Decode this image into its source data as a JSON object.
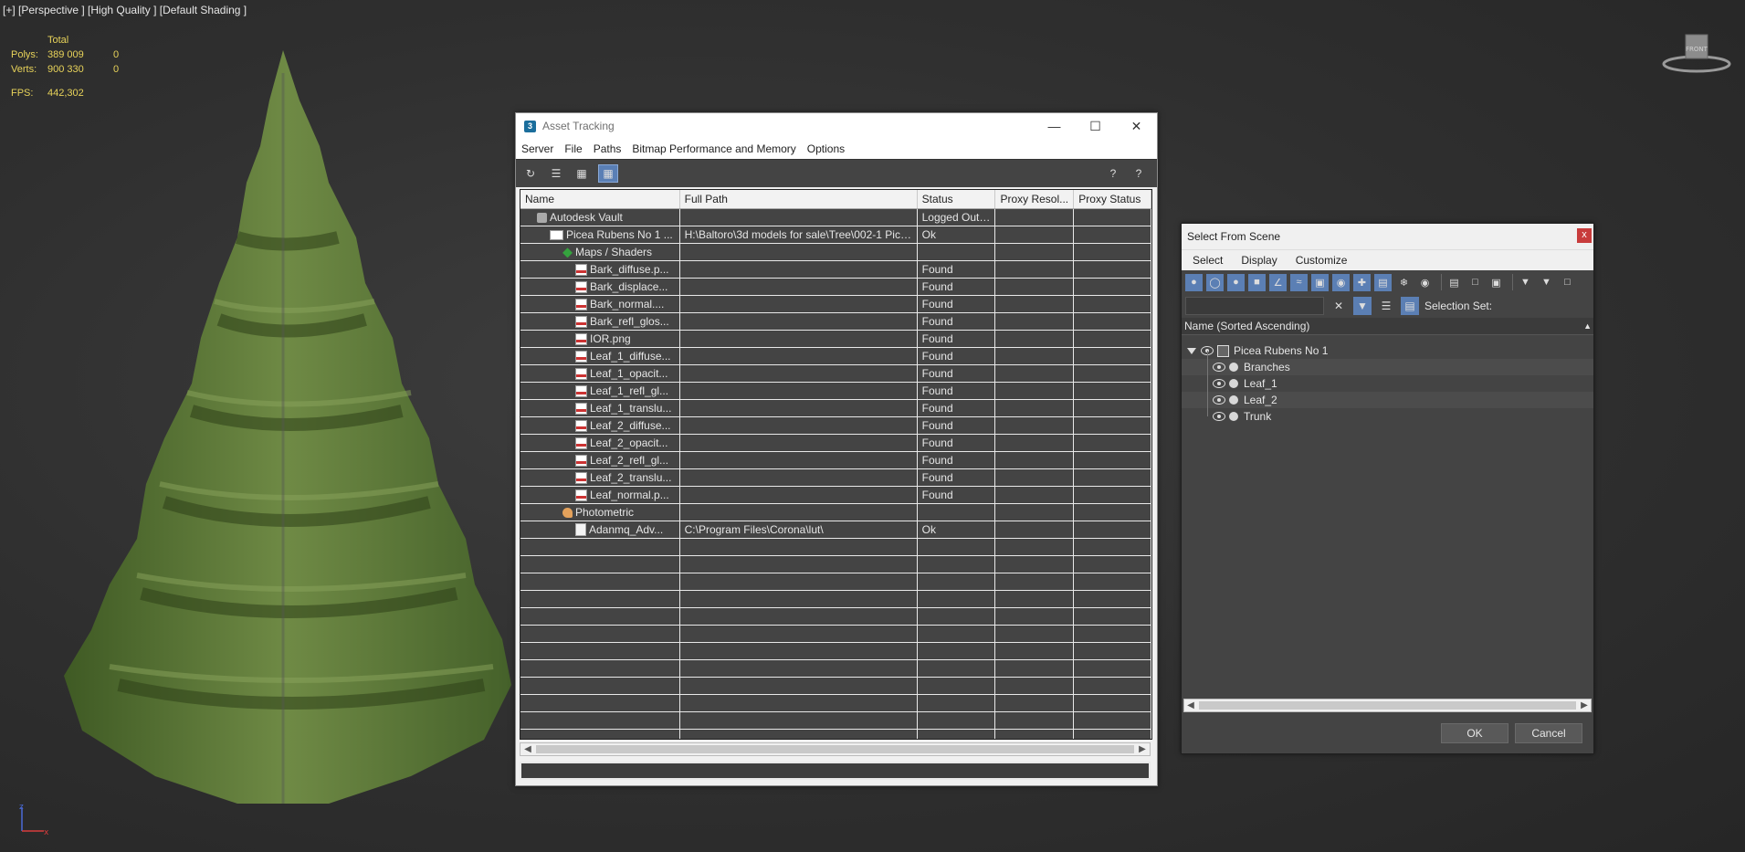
{
  "viewport": {
    "label": "[+] [Perspective ] [High Quality ] [Default Shading ]",
    "stats": {
      "header": "Total",
      "polys_label": "Polys:",
      "polys_total": "389 009",
      "polys_sel": "0",
      "verts_label": "Verts:",
      "verts_total": "900 330",
      "verts_sel": "0",
      "fps_label": "FPS:",
      "fps_value": "442,302"
    },
    "viewcube_label": "FRONT",
    "axis": {
      "z": "z",
      "x": "x"
    }
  },
  "asset_tracking": {
    "title": "Asset Tracking",
    "menu": [
      "Server",
      "File",
      "Paths",
      "Bitmap Performance and Memory",
      "Options"
    ],
    "columns": [
      "Name",
      "Full Path",
      "Status",
      "Proxy Resol...",
      "Proxy Status"
    ],
    "rows": [
      {
        "icon": "vault-icon",
        "indent": 1,
        "name": "Autodesk Vault",
        "path": "",
        "status": "Logged Out ...",
        "res": "",
        "pstatus": ""
      },
      {
        "icon": "scene-file-icon",
        "indent": 2,
        "name": "Picea Rubens No 1 ...",
        "path": "H:\\Baltoro\\3d models for sale\\Tree\\002-1 Pice...",
        "status": "Ok",
        "res": "",
        "pstatus": ""
      },
      {
        "icon": "maps-icon",
        "indent": 3,
        "name": "Maps / Shaders",
        "path": "",
        "status": "",
        "res": "",
        "pstatus": ""
      },
      {
        "icon": "png-icon",
        "indent": 4,
        "name": "Bark_diffuse.p...",
        "path": "",
        "status": "Found",
        "res": "",
        "pstatus": ""
      },
      {
        "icon": "png-icon",
        "indent": 4,
        "name": "Bark_displace...",
        "path": "",
        "status": "Found",
        "res": "",
        "pstatus": ""
      },
      {
        "icon": "png-icon",
        "indent": 4,
        "name": "Bark_normal....",
        "path": "",
        "status": "Found",
        "res": "",
        "pstatus": ""
      },
      {
        "icon": "png-icon",
        "indent": 4,
        "name": "Bark_refl_glos...",
        "path": "",
        "status": "Found",
        "res": "",
        "pstatus": ""
      },
      {
        "icon": "png-icon",
        "indent": 4,
        "name": "IOR.png",
        "path": "",
        "status": "Found",
        "res": "",
        "pstatus": ""
      },
      {
        "icon": "png-icon",
        "indent": 4,
        "name": "Leaf_1_diffuse...",
        "path": "",
        "status": "Found",
        "res": "",
        "pstatus": ""
      },
      {
        "icon": "png-icon",
        "indent": 4,
        "name": "Leaf_1_opacit...",
        "path": "",
        "status": "Found",
        "res": "",
        "pstatus": ""
      },
      {
        "icon": "png-icon",
        "indent": 4,
        "name": "Leaf_1_refl_gl...",
        "path": "",
        "status": "Found",
        "res": "",
        "pstatus": ""
      },
      {
        "icon": "png-icon",
        "indent": 4,
        "name": "Leaf_1_translu...",
        "path": "",
        "status": "Found",
        "res": "",
        "pstatus": ""
      },
      {
        "icon": "png-icon",
        "indent": 4,
        "name": "Leaf_2_diffuse...",
        "path": "",
        "status": "Found",
        "res": "",
        "pstatus": ""
      },
      {
        "icon": "png-icon",
        "indent": 4,
        "name": "Leaf_2_opacit...",
        "path": "",
        "status": "Found",
        "res": "",
        "pstatus": ""
      },
      {
        "icon": "png-icon",
        "indent": 4,
        "name": "Leaf_2_refl_gl...",
        "path": "",
        "status": "Found",
        "res": "",
        "pstatus": ""
      },
      {
        "icon": "png-icon",
        "indent": 4,
        "name": "Leaf_2_translu...",
        "path": "",
        "status": "Found",
        "res": "",
        "pstatus": ""
      },
      {
        "icon": "png-icon",
        "indent": 4,
        "name": "Leaf_normal.p...",
        "path": "",
        "status": "Found",
        "res": "",
        "pstatus": ""
      },
      {
        "icon": "photometric-icon",
        "indent": 3,
        "name": "Photometric",
        "path": "",
        "status": "",
        "res": "",
        "pstatus": ""
      },
      {
        "icon": "document-icon",
        "indent": 4,
        "name": "Adanmq_Adv...",
        "path": "C:\\Program Files\\Corona\\lut\\",
        "status": "Ok",
        "res": "",
        "pstatus": ""
      }
    ]
  },
  "select_from_scene": {
    "title": "Select From Scene",
    "close": "x",
    "menu": [
      "Select",
      "Display",
      "Customize"
    ],
    "selection_set_label": "Selection Set:",
    "column_header": "Name (Sorted Ascending)",
    "sort_arrow": "▲",
    "root": "Picea Rubens No 1",
    "children": [
      "Branches",
      "Leaf_1",
      "Leaf_2",
      "Trunk"
    ],
    "ok_label": "OK",
    "cancel_label": "Cancel"
  }
}
